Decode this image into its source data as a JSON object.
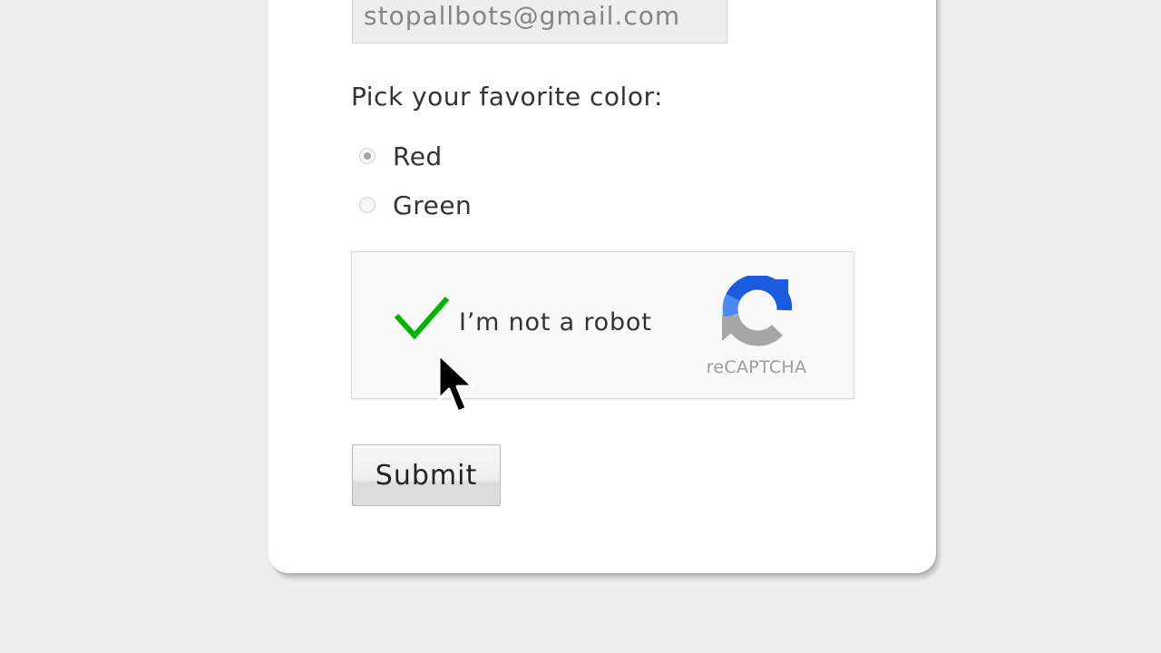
{
  "form": {
    "email_value": "stopallbots@gmail.com",
    "color_question": "Pick your favorite color:",
    "color_options": [
      {
        "label": "Red",
        "checked": true
      },
      {
        "label": "Green",
        "checked": false
      }
    ],
    "submit_label": "Submit"
  },
  "recaptcha": {
    "label": "I’m not a robot",
    "brand": "reCAPTCHA",
    "checked": true,
    "check_icon": "checkmark-icon",
    "logo_icon": "recaptcha-logo-icon"
  },
  "colors": {
    "background": "#eeeeee",
    "card": "#ffffff",
    "checkmark": "#00b400",
    "recaptcha_blue": "#1a5be0",
    "recaptcha_light_blue": "#4a8af4",
    "recaptcha_gray": "#a6a6a6"
  }
}
